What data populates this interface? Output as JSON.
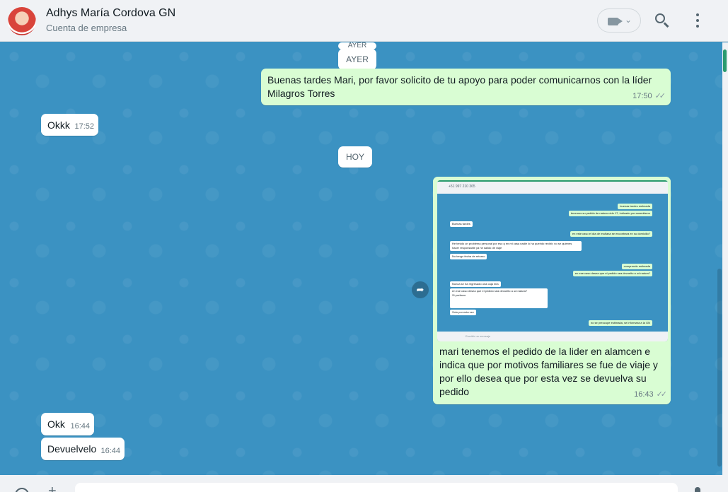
{
  "header": {
    "contact_name": "Adhys María Cordova GN",
    "contact_subtitle": "Cuenta de empresa",
    "video_icon": "video-camera-icon",
    "search_icon": "search-icon",
    "menu_icon": "kebab-menu-icon"
  },
  "chat": {
    "date_ayer_top": "AYER",
    "date_ayer": "AYER",
    "date_hoy": "HOY",
    "messages": [
      {
        "direction": "out",
        "text": "Buenas tardes Mari, por favor solicito de tu apoyo para poder comunicarnos con la líder Milagros Torres",
        "time": "17:50",
        "status": "read"
      },
      {
        "direction": "in",
        "text": "Okkk",
        "time": "17:52"
      },
      {
        "direction": "out",
        "type": "image",
        "caption": "mari tenemos el pedido de la lider en alamcen e indica que por motivos familiares se fue de viaje y por ello desea que por esta vez se devuelva su pedido",
        "time": "16:43",
        "status": "read"
      },
      {
        "direction": "in",
        "text": "Okk",
        "time": "16:44"
      },
      {
        "direction": "in",
        "text": "Devuelvelo",
        "time": "16:44"
      }
    ],
    "forward_icon": "forward-arrow-icon"
  },
  "screenshot_preview": {
    "title": "+51 997 210 365",
    "footer_placeholder": "Escribir un mensaje",
    "lines": [
      {
        "dir": "out",
        "text": "buenas tardes estimada"
      },
      {
        "dir": "out",
        "text": "tenemos su pedido de natura ciclo 17, indicado por ausentismo"
      },
      {
        "dir": "in",
        "text": "Buenas tardes"
      },
      {
        "dir": "out",
        "text": "en este caso el día de mañana se encontrara en su domicilio?"
      },
      {
        "dir": "in",
        "text": "He tenido un problema personal por eso q en mi casa nadie lo ha querido recibir, no se quienes hacer responsable ya he salido de viaje"
      },
      {
        "dir": "in",
        "text": "No tengo fecha de retorno"
      },
      {
        "dir": "out",
        "text": "comprendo estimada"
      },
      {
        "dir": "out",
        "text": "en ese caso desea que el pedido sea devuelto a ud natura?"
      },
      {
        "dir": "in",
        "text": "Nunca se ha regresado una caja mía"
      },
      {
        "dir": "in",
        "text": "en ese caso desea que el pedido sea devuelto a ud natura?"
      },
      {
        "dir": "in",
        "text": "Si porfavor"
      },
      {
        "dir": "in",
        "text": "Solo por esta vez"
      },
      {
        "dir": "out",
        "text": "no se preocupe estimada, se informara a la GN"
      }
    ]
  }
}
